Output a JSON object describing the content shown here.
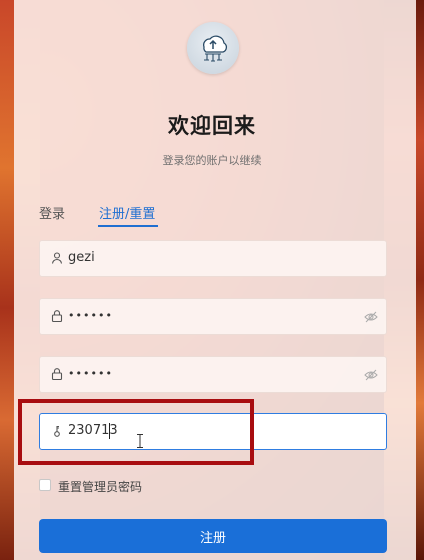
{
  "header": {
    "logo_icon": "cloud-network-icon",
    "title": "欢迎回来",
    "subtitle": "登录您的账户以继续"
  },
  "tabs": [
    {
      "label": "登录",
      "active": false
    },
    {
      "label": "注册/重置",
      "active": true
    }
  ],
  "form": {
    "username": {
      "icon": "user-icon",
      "value": "gezi"
    },
    "password": {
      "icon": "lock-icon",
      "value": "••••••",
      "toggle_icon": "eye-off-icon"
    },
    "confirm_password": {
      "icon": "lock-icon",
      "value": "••••••",
      "toggle_icon": "eye-off-icon"
    },
    "invite_code": {
      "icon": "key-icon",
      "value": "230713"
    },
    "reset_admin": {
      "label": "重置管理员密码",
      "checked": false
    },
    "submit_label": "注册"
  },
  "colors": {
    "accent": "#1a6fd8",
    "highlight_box": "#a80d10"
  }
}
